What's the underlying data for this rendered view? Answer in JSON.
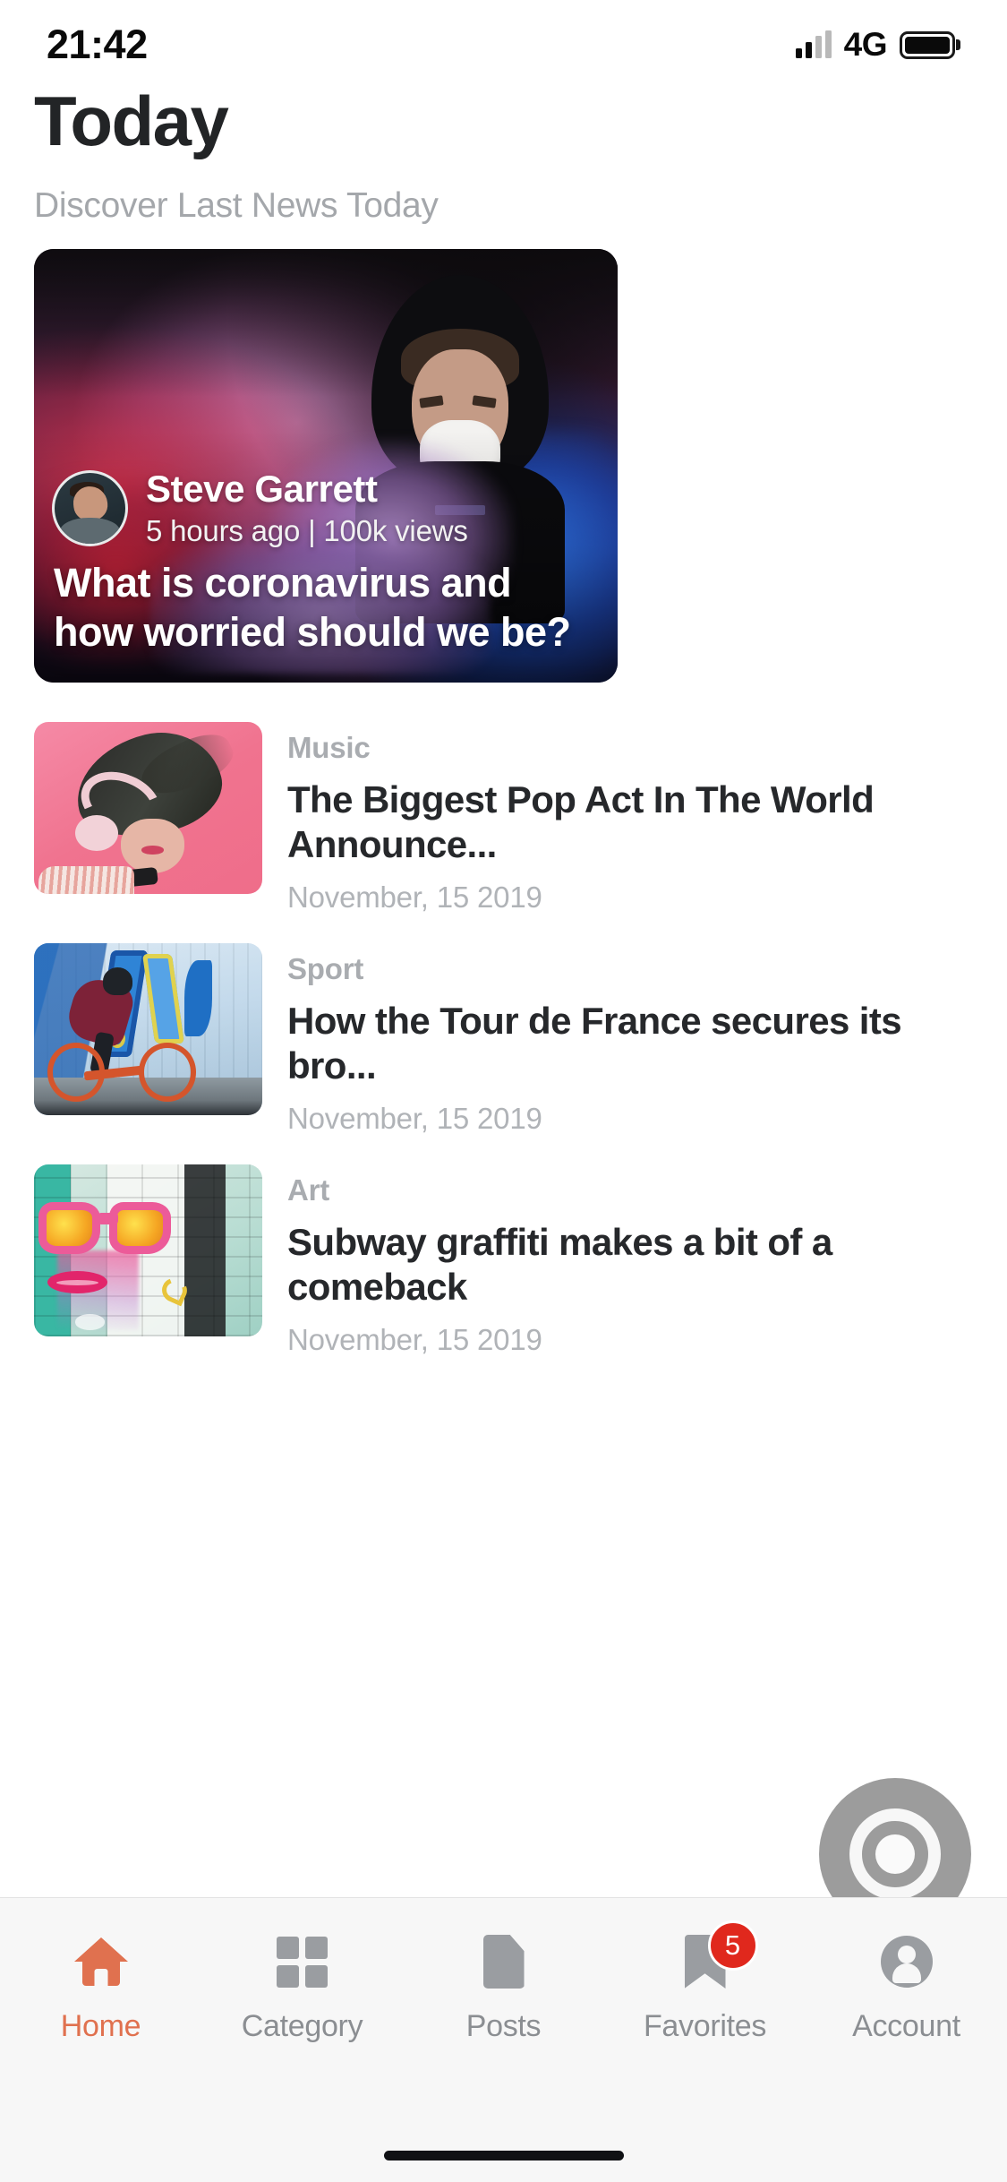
{
  "status_bar": {
    "time": "21:42",
    "network": "4G",
    "signal_icon": "signal-bars-icon",
    "battery_icon": "battery-full-icon"
  },
  "header": {
    "title": "Today",
    "subtitle": "Discover Last News Today"
  },
  "hero": {
    "author": "Steve Garrett",
    "meta": "5 hours ago | 100k views",
    "headline": "What is coronavirus and how worried should we be?",
    "avatar_icon": "author-avatar"
  },
  "articles": [
    {
      "category": "Music",
      "title": "The Biggest Pop Act In The World Announce...",
      "date": "November, 15 2019",
      "thumb_icon": "music-thumbnail"
    },
    {
      "category": "Sport",
      "title": "How the Tour de France secures its bro...",
      "date": "November, 15 2019",
      "thumb_icon": "sport-thumbnail"
    },
    {
      "category": "Art",
      "title": "Subway graffiti makes a bit of a comeback",
      "date": "November, 15 2019",
      "thumb_icon": "art-thumbnail"
    }
  ],
  "recorder": {
    "icon": "screen-record-button"
  },
  "tabbar": {
    "items": [
      {
        "label": "Home",
        "icon": "home-icon",
        "active": true
      },
      {
        "label": "Category",
        "icon": "grid-icon",
        "active": false
      },
      {
        "label": "Posts",
        "icon": "document-icon",
        "active": false
      },
      {
        "label": "Favorites",
        "icon": "bookmark-icon",
        "active": false,
        "badge": "5"
      },
      {
        "label": "Account",
        "icon": "account-icon",
        "active": false
      }
    ]
  },
  "colors": {
    "accent": "#e0714f",
    "badge": "#e0281d",
    "title": "#26282b",
    "muted": "#a9acb0",
    "tabbar_bg": "#f7f7f7"
  }
}
